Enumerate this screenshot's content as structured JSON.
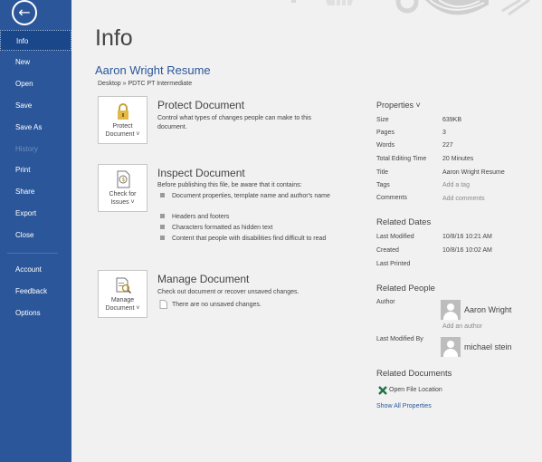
{
  "sidebar": {
    "back_icon": "back-arrow-icon",
    "items": [
      {
        "label": "Info"
      },
      {
        "label": "New"
      },
      {
        "label": "Open"
      },
      {
        "label": "Save"
      },
      {
        "label": "Save As"
      },
      {
        "label": "History"
      },
      {
        "label": "Print"
      },
      {
        "label": "Share"
      },
      {
        "label": "Export"
      },
      {
        "label": "Close"
      },
      {
        "label": "Account"
      },
      {
        "label": "Feedback"
      },
      {
        "label": "Options"
      }
    ]
  },
  "main": {
    "title": "Info",
    "doc_name": "Aaron Wright Resume",
    "path": "Desktop » PDTC PT Intermediate",
    "protect": {
      "btn_line1": "Protect",
      "btn_line2": "Document ˅",
      "heading": "Protect Document",
      "desc": "Control what types of changes people can make to this document."
    },
    "inspect": {
      "btn_line1": "Check for",
      "btn_line2": "Issues ˅",
      "heading": "Inspect Document",
      "desc": "Before publishing this file, be aware that it contains:",
      "bullets": [
        "Document properties, template name and author's name",
        "Headers and footers",
        "Characters formatted as hidden text",
        "Content that people with disabilities find difficult to read"
      ]
    },
    "manage": {
      "btn_line1": "Manage",
      "btn_line2": "Document ˅",
      "heading": "Manage Document",
      "desc": "Check out document or recover unsaved changes.",
      "note": "There are no unsaved changes."
    }
  },
  "properties": {
    "heading": "Properties ˅",
    "rows": [
      {
        "label": "Size",
        "value": "639KB"
      },
      {
        "label": "Pages",
        "value": "3"
      },
      {
        "label": "Words",
        "value": "227"
      },
      {
        "label": "Total Editing Time",
        "value": "20 Minutes"
      },
      {
        "label": "Title",
        "value": "Aaron Wright Resume"
      },
      {
        "label": "Tags",
        "value": "Add a tag"
      },
      {
        "label": "Comments",
        "value": "Add comments"
      }
    ],
    "dates_heading": "Related Dates",
    "dates": [
      {
        "label": "Last Modified",
        "value": "10/8/16 10:21 AM"
      },
      {
        "label": "Created",
        "value": "10/8/16 10:02 AM"
      },
      {
        "label": "Last Printed",
        "value": ""
      }
    ],
    "people_heading": "Related People",
    "author_label": "Author",
    "author_name": "Aaron Wright",
    "add_author": "Add an author",
    "modified_by_label": "Last Modified By",
    "modified_by_name": "michael stein",
    "docs_heading": "Related Documents",
    "open_location": "Open File Location",
    "show_all": "Show All Properties"
  },
  "colors": {
    "sidebar": "#2b579a",
    "accent_link": "#2b579a",
    "excel_green": "#217346"
  }
}
